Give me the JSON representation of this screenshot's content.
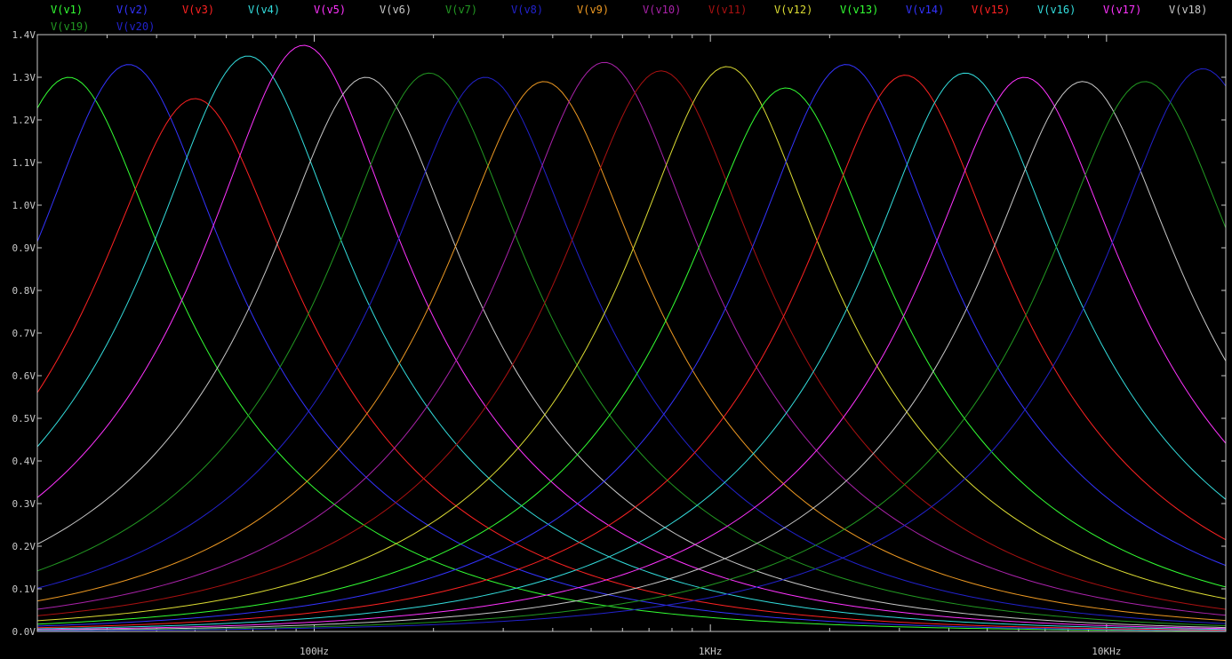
{
  "chart_data": {
    "type": "line",
    "title": "",
    "xlabel": "",
    "ylabel": "",
    "x_scale": "log",
    "xlim": [
      20,
      20000
    ],
    "ylim": [
      0,
      1.4
    ],
    "grid": false,
    "legend_position": "top-left",
    "x_tick_labels": [
      {
        "value": 100,
        "label": "100Hz"
      },
      {
        "value": 1000,
        "label": "1KHz"
      },
      {
        "value": 10000,
        "label": "10KHz"
      }
    ],
    "y_ticks": [
      {
        "value": 0.0,
        "label": "0.0V"
      },
      {
        "value": 0.1,
        "label": "0.1V"
      },
      {
        "value": 0.2,
        "label": "0.2V"
      },
      {
        "value": 0.3,
        "label": "0.3V"
      },
      {
        "value": 0.4,
        "label": "0.4V"
      },
      {
        "value": 0.5,
        "label": "0.5V"
      },
      {
        "value": 0.6,
        "label": "0.6V"
      },
      {
        "value": 0.7,
        "label": "0.7V"
      },
      {
        "value": 0.8,
        "label": "0.8V"
      },
      {
        "value": 0.9,
        "label": "0.9V"
      },
      {
        "value": 1.0,
        "label": "1.0V"
      },
      {
        "value": 1.1,
        "label": "1.1V"
      },
      {
        "value": 1.2,
        "label": "1.2V"
      },
      {
        "value": 1.3,
        "label": "1.3V"
      },
      {
        "value": 1.4,
        "label": "1.4V"
      }
    ],
    "series": [
      {
        "name": "V(v1)",
        "color": "#33ff33",
        "peak_freq": 24,
        "peak_value": 1.3
      },
      {
        "name": "V(v2)",
        "color": "#3333ff",
        "peak_freq": 34,
        "peak_value": 1.33
      },
      {
        "name": "V(v3)",
        "color": "#ff2222",
        "peak_freq": 50,
        "peak_value": 1.25
      },
      {
        "name": "V(v4)",
        "color": "#33dddd",
        "peak_freq": 68,
        "peak_value": 1.35
      },
      {
        "name": "V(v5)",
        "color": "#ff33ff",
        "peak_freq": 94,
        "peak_value": 1.375
      },
      {
        "name": "V(v6)",
        "color": "#c8c8c8",
        "peak_freq": 135,
        "peak_value": 1.3
      },
      {
        "name": "V(v7)",
        "color": "#229922",
        "peak_freq": 195,
        "peak_value": 1.31
      },
      {
        "name": "V(v8)",
        "color": "#2222cc",
        "peak_freq": 270,
        "peak_value": 1.3
      },
      {
        "name": "V(v9)",
        "color": "#ee9922",
        "peak_freq": 380,
        "peak_value": 1.29
      },
      {
        "name": "V(v10)",
        "color": "#aa22aa",
        "peak_freq": 540,
        "peak_value": 1.335
      },
      {
        "name": "V(v11)",
        "color": "#aa1111",
        "peak_freq": 750,
        "peak_value": 1.315
      },
      {
        "name": "V(v12)",
        "color": "#dddd33",
        "peak_freq": 1100,
        "peak_value": 1.325
      },
      {
        "name": "V(v13)",
        "color": "#33ff33",
        "peak_freq": 1550,
        "peak_value": 1.275
      },
      {
        "name": "V(v14)",
        "color": "#3333ff",
        "peak_freq": 2200,
        "peak_value": 1.33
      },
      {
        "name": "V(v15)",
        "color": "#ff2222",
        "peak_freq": 3100,
        "peak_value": 1.305
      },
      {
        "name": "V(v16)",
        "color": "#33dddd",
        "peak_freq": 4400,
        "peak_value": 1.31
      },
      {
        "name": "V(v17)",
        "color": "#ff33ff",
        "peak_freq": 6200,
        "peak_value": 1.3
      },
      {
        "name": "V(v18)",
        "color": "#c8c8c8",
        "peak_freq": 8700,
        "peak_value": 1.29
      },
      {
        "name": "V(v19)",
        "color": "#229922",
        "peak_freq": 12500,
        "peak_value": 1.29
      },
      {
        "name": "V(v20)",
        "color": "#2222cc",
        "peak_freq": 17500,
        "peak_value": 1.32
      }
    ]
  }
}
